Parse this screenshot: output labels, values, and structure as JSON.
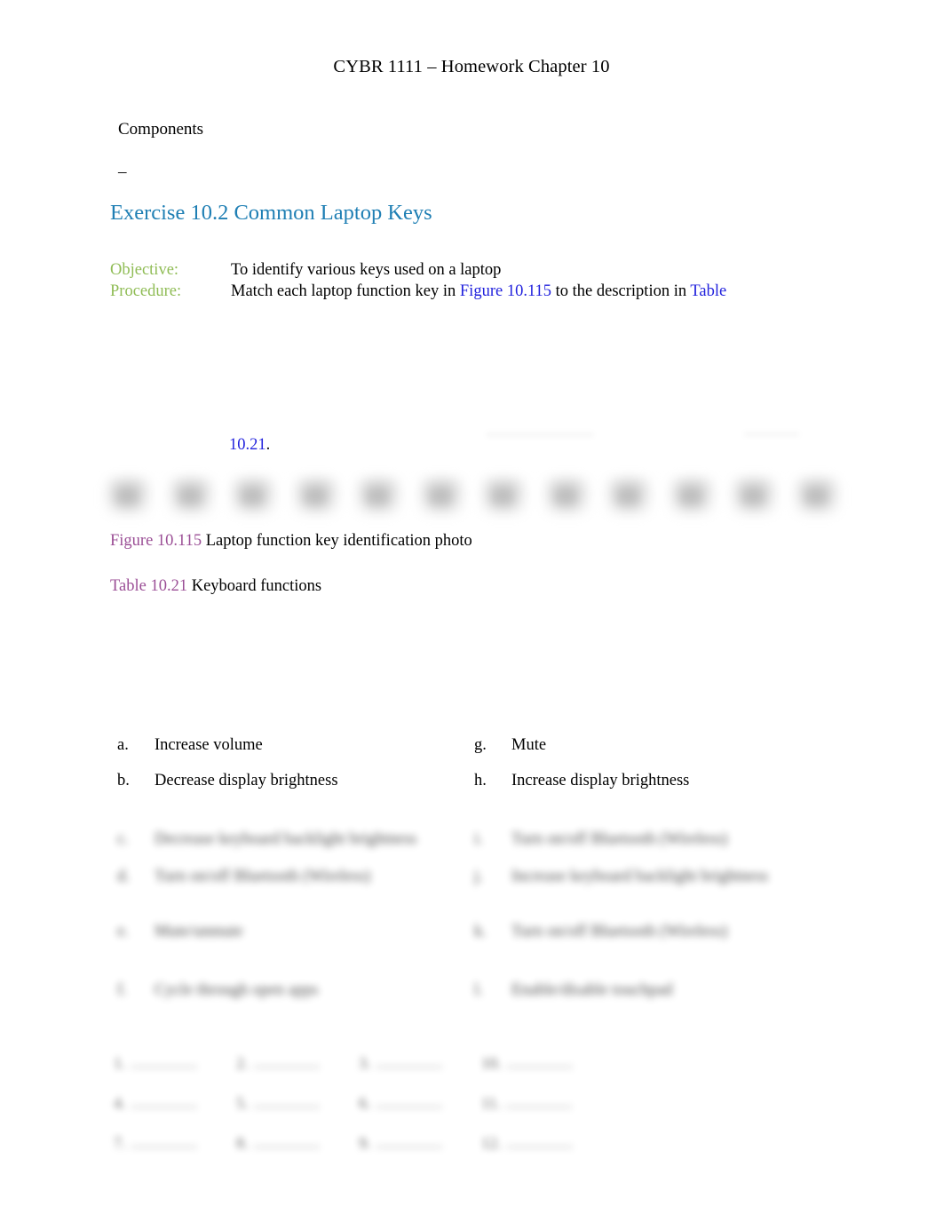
{
  "document": {
    "title": "CYBR 1111 – Homework Chapter 10",
    "components_label": "Components",
    "components_dash": "–"
  },
  "exercise": {
    "heading": "Exercise 10.2 Common Laptop Keys",
    "objective_label": "Objective:",
    "objective_text": "To identify various keys used on a laptop",
    "procedure_label": "Procedure:",
    "procedure_prefix": "Match each laptop function key in ",
    "procedure_figure_ref": "Figure 10.115",
    "procedure_middle": " to the description in ",
    "procedure_table_ref": "Table",
    "procedure_wrapped_ref": "10.21",
    "procedure_wrapped_tail": "."
  },
  "captions": {
    "figure_ref": "Figure 10.115",
    "figure_text": " Laptop function key identification photo",
    "table_ref": "Table 10.21",
    "table_text": " Keyboard functions"
  },
  "figure": {
    "key_count": 12
  },
  "options": {
    "left": [
      {
        "marker": "a.",
        "text": "Increase volume",
        "blurred": false
      },
      {
        "marker": "b.",
        "text": "Decrease display brightness",
        "blurred": false
      },
      {
        "marker": "c.",
        "text": "Decrease keyboard backlight brightness",
        "blurred": true
      },
      {
        "marker": "d.",
        "text": "Turn on/off Bluetooth (Wireless)",
        "blurred": true
      },
      {
        "marker": "e.",
        "text": "Mute/unmute",
        "blurred": true
      },
      {
        "marker": "f.",
        "text": "Cycle through open apps",
        "blurred": true
      }
    ],
    "right": [
      {
        "marker": "g.",
        "text": "Mute",
        "blurred": false
      },
      {
        "marker": "h.",
        "text": "Increase display brightness",
        "blurred": false
      },
      {
        "marker": "i.",
        "text": "Turn on/off Bluetooth (Wireless)",
        "blurred": true
      },
      {
        "marker": "j.",
        "text": "Increase keyboard backlight brightness",
        "blurred": true
      },
      {
        "marker": "k.",
        "text": "Turn on/off Bluetooth (Wireless)",
        "blurred": true
      },
      {
        "marker": "l.",
        "text": "Enable/disable touchpad",
        "blurred": true
      }
    ]
  },
  "answer_blanks": [
    {
      "number": "1."
    },
    {
      "number": "2."
    },
    {
      "number": "3."
    },
    {
      "number": "10."
    },
    {
      "number": "4."
    },
    {
      "number": "5."
    },
    {
      "number": "6."
    },
    {
      "number": "11."
    },
    {
      "number": "7."
    },
    {
      "number": "8."
    },
    {
      "number": "9."
    },
    {
      "number": "12."
    }
  ],
  "colors": {
    "heading_blue": "#1F7FB4",
    "label_green": "#8FBC55",
    "hyperlink_blue": "#2222DD",
    "caption_purple": "#9B4F96",
    "body_black": "#000000",
    "page_background": "#FFFFFF"
  }
}
